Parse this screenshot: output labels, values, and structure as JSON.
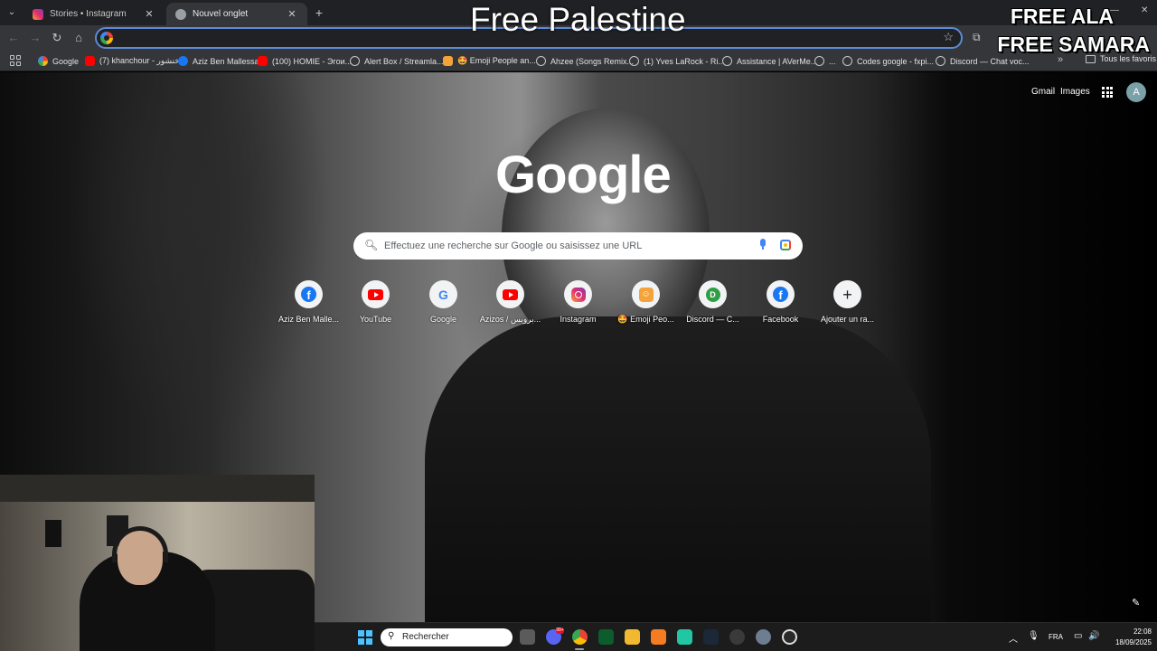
{
  "browser": {
    "tabs": [
      {
        "label": "Stories • Instagram",
        "close": "✕"
      },
      {
        "label": "Nouvel onglet",
        "close": "✕"
      }
    ],
    "new_tab": "+",
    "window_controls": {
      "minimize": "—",
      "maximize": "▢",
      "close": "✕"
    },
    "toolbar": {
      "back": "←",
      "forward": "→",
      "reload": "↻",
      "home": "⌂",
      "star": "☆",
      "extensions": "⧉"
    },
    "omnibox": {
      "value": "",
      "placeholder": ""
    }
  },
  "bookmarks": {
    "items": [
      {
        "label": "Google",
        "icon": "google-icon"
      },
      {
        "label": "(7) khanchour - خنشور",
        "icon": "youtube-icon"
      },
      {
        "label": "Aziz Ben Mallessa",
        "icon": "facebook-icon"
      },
      {
        "label": "(100) HOMIE - Эгои...",
        "icon": "youtube-icon"
      },
      {
        "label": "Alert Box / Streamla...",
        "icon": "globe-icon"
      },
      {
        "label": "🤩 Emoji People an...",
        "icon": "emoji-icon"
      },
      {
        "label": "Ahzee (Songs Remix...",
        "icon": "globe-icon"
      },
      {
        "label": "(1) Yves LaRock - Ri...",
        "icon": "globe-icon"
      },
      {
        "label": "Assistance | AVerMe...",
        "icon": "globe-icon"
      },
      {
        "label": "...",
        "icon": "globe-icon"
      },
      {
        "label": "Codes google - fxpi...",
        "icon": "globe-icon"
      },
      {
        "label": "Discord — Chat voc...",
        "icon": "globe-icon"
      }
    ],
    "more": "»",
    "all_bookmarks": "Tous les favoris"
  },
  "overlay": {
    "title": "Free Palestine",
    "line1": "FREE ALA",
    "line2": "FREE SAMARA"
  },
  "page": {
    "gmail": "Gmail",
    "images": "Images",
    "avatar_letter": "A",
    "logo": "Google",
    "search_placeholder": "Effectuez une recherche sur Google ou saisissez une URL",
    "shortcuts": [
      {
        "label": "Aziz Ben Malle...",
        "icon": "facebook-icon"
      },
      {
        "label": "YouTube",
        "icon": "youtube-icon"
      },
      {
        "label": "Google",
        "icon": "google-icon"
      },
      {
        "label": "Azizos / بروبس...",
        "icon": "youtube-icon"
      },
      {
        "label": "Instagram",
        "icon": "instagram-icon"
      },
      {
        "label": "🤩 Emoji Peo...",
        "icon": "emoji-icon"
      },
      {
        "label": "Discord — C...",
        "icon": "discord-icon"
      },
      {
        "label": "Facebook",
        "icon": "facebook-icon"
      },
      {
        "label": "Ajouter un ra...",
        "icon": "plus-icon"
      }
    ],
    "discord_letter": "D",
    "fb_letter": "f",
    "g_letter": "G",
    "edit": "✎"
  },
  "taskbar": {
    "search_label": "Rechercher",
    "badge": "99+",
    "language": "FRA",
    "time": "22:08",
    "date": "18/09/2025",
    "tray_up": "︿",
    "tray_mic": "🎙",
    "tray_net": "▭",
    "tray_sound": "🔊"
  },
  "colors": {
    "accent": "#5b8bd6",
    "tab_bg": "#202124",
    "toolbar_bg": "#35363a",
    "start_blue": "#4cc2ff"
  }
}
